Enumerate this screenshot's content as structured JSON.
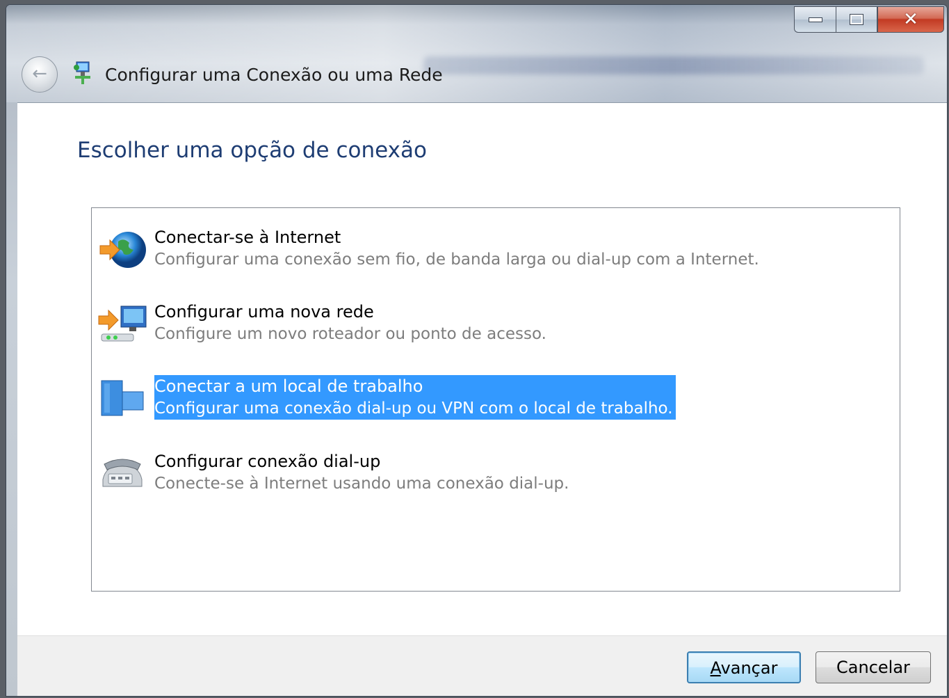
{
  "window": {
    "title": "Configurar uma Conexão ou uma Rede",
    "controls": {
      "minimize": "minimize-icon",
      "maximize": "maximize-icon",
      "close": "close-icon"
    }
  },
  "heading": "Escolher uma opção de conexão",
  "options": [
    {
      "title": "Conectar-se à Internet",
      "description": "Configurar uma conexão sem fio, de banda larga ou dial-up com a Internet.",
      "icon": "globe-arrow-icon",
      "selected": false
    },
    {
      "title": "Configurar uma nova rede",
      "description": "Configure um novo roteador ou ponto de acesso.",
      "icon": "network-router-icon",
      "selected": false
    },
    {
      "title": "Conectar a um local de trabalho",
      "description": "Configurar uma conexão dial-up ou VPN com o local de trabalho.",
      "icon": "workplace-icon",
      "selected": true
    },
    {
      "title": "Configurar conexão dial-up",
      "description": "Conecte-se à Internet usando uma conexão dial-up.",
      "icon": "telephone-icon",
      "selected": false
    }
  ],
  "buttons": {
    "next_prefix": "A",
    "next_rest": "vançar",
    "cancel": "Cancelar"
  },
  "colors": {
    "selection": "#3399ff",
    "heading": "#1e3d73",
    "description": "#7d7d7d"
  }
}
